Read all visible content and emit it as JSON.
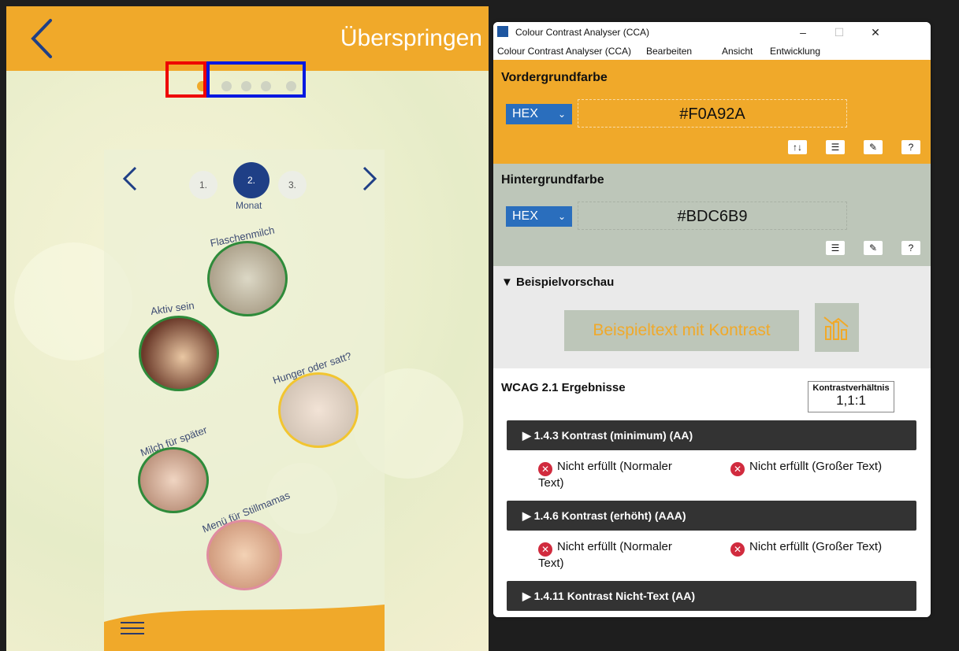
{
  "app": {
    "skip_label": "Überspringen",
    "months": [
      "1.",
      "2.",
      "3."
    ],
    "month_label": "Monat",
    "photo_labels": [
      "Flaschenmilch",
      "Aktiv sein",
      "Hunger oder satt?",
      "Milch für später",
      "Menü für Stillmamas"
    ],
    "colors": {
      "header": "#f0a92a",
      "active_month": "#1f3f86"
    }
  },
  "cca": {
    "window_title": "Colour Contrast Analyser (CCA)",
    "menu": [
      "Colour Contrast Analyser (CCA)",
      "Bearbeiten",
      "Ansicht",
      "Entwicklung"
    ],
    "foreground": {
      "title": "Vordergrundfarbe",
      "format": "HEX",
      "value": "#F0A92A"
    },
    "background": {
      "title": "Hintergrundfarbe",
      "format": "HEX",
      "value": "#BDC6B9"
    },
    "preview": {
      "title": "▼ Beispielvorschau",
      "sample_text": "Beispieltext mit Kontrast"
    },
    "results": {
      "title": "WCAG 2.1 Ergebnisse",
      "ratio_label": "Kontrastverhältnis",
      "ratio_value": "1,1:1",
      "criteria": [
        {
          "label": "▶ 1.4.3 Kontrast (minimum) (AA)",
          "normal": "Nicht erfüllt (Normaler Text)",
          "large": "Nicht erfüllt (Großer Text)"
        },
        {
          "label": "▶ 1.4.6 Kontrast (erhöht) (AAA)",
          "normal": "Nicht erfüllt (Normaler Text)",
          "large": "Nicht erfüllt (Großer Text)"
        },
        {
          "label": "▶ 1.4.11 Kontrast Nicht-Text (AA)"
        }
      ]
    }
  }
}
